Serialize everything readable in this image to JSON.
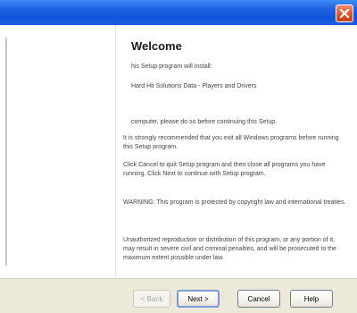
{
  "titlebar": {
    "close_label": "×"
  },
  "content": {
    "heading": "Welcome",
    "line1": "his Setup program will install:",
    "line2": "Hard Hit Solutions Data - Players and Drivers",
    "cut_line": "computer, please do so before continuing this Setup.",
    "para1": "It is strongly recommended that you exit all Windows programs before running this Setup program.",
    "para2": "Click Cancel to quit Setup program and then close all programs you have running. Click Next to continue with Setup program.",
    "para3": "WARNING: This program is protected by copyright law and international treaties.",
    "para4": "Unauthorized reproduction or distribution of this program, or any portion of it, may result in severe civil and criminal penalties, and will be prosecuted to the maximum extent possible under law."
  },
  "footer": {
    "back_label": "< Back",
    "next_label": "Next >",
    "cancel_label": "Cancel",
    "help_label": "Help"
  }
}
